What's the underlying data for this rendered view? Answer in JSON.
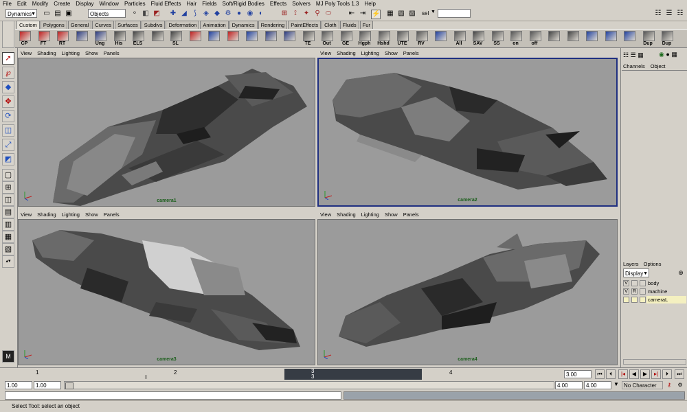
{
  "menubar": [
    "File",
    "Edit",
    "Modify",
    "Create",
    "Display",
    "Window",
    "Particles",
    "Fluid Effects",
    "Hair",
    "Fields",
    "Soft/Rigid Bodies",
    "Effects",
    "Solvers",
    "MJ Poly Tools 1.3",
    "Help"
  ],
  "statusline": {
    "menu_set": "Dynamics",
    "selection_mode": "Objects",
    "sel_label": "sel"
  },
  "shelf_tabs": [
    "Custom",
    "Polygons",
    "General",
    "Curves",
    "Surfaces",
    "Subdivs",
    "Deformation",
    "Animation",
    "Dynamics",
    "Rendering",
    "PaintEffects",
    "Cloth",
    "Fluids",
    "Fur"
  ],
  "shelf_buttons": [
    "CP",
    "FT",
    "RT",
    "",
    "Ung",
    "His",
    "ELS",
    "",
    "SL",
    "",
    "",
    "",
    "",
    "",
    "",
    "TE",
    "Out",
    "GE",
    "Hgph",
    "Hshd",
    "UTE",
    "RV",
    "",
    "All",
    "SAV",
    "SS",
    "on",
    "off",
    "",
    "",
    "",
    "",
    "",
    "Dup",
    "Dup"
  ],
  "viewports": {
    "menu": [
      "View",
      "Shading",
      "Lighting",
      "Show",
      "Panels"
    ],
    "cameras": [
      "camera1",
      "camera2",
      "camera3",
      "camera4"
    ]
  },
  "channel_box": {
    "tabs": [
      "Channels",
      "Object"
    ]
  },
  "layers": {
    "menu": [
      "Layers",
      "Options"
    ],
    "display_option": "Display",
    "rows": [
      {
        "v": "V",
        "r": "",
        "name": "body"
      },
      {
        "v": "V",
        "r": "R",
        "name": "machine"
      },
      {
        "v": "",
        "r": "",
        "name": "cameraL"
      }
    ]
  },
  "timeline": {
    "ticks": [
      "1",
      "2",
      "3",
      "4"
    ],
    "current_frame_marker": "3",
    "current_time": "3.00"
  },
  "range": {
    "start": "1.00",
    "playback_start": "1.00",
    "playback_end": "4.00",
    "end": "4.00",
    "character_set": "No Character Set"
  },
  "help_line": "Select Tool: select an object",
  "colors": {
    "viewport_bg": "#9b9b9b",
    "active_border": "#1f2f80",
    "camera_label": "#1b5e1b",
    "current_frame": "#363c44"
  }
}
